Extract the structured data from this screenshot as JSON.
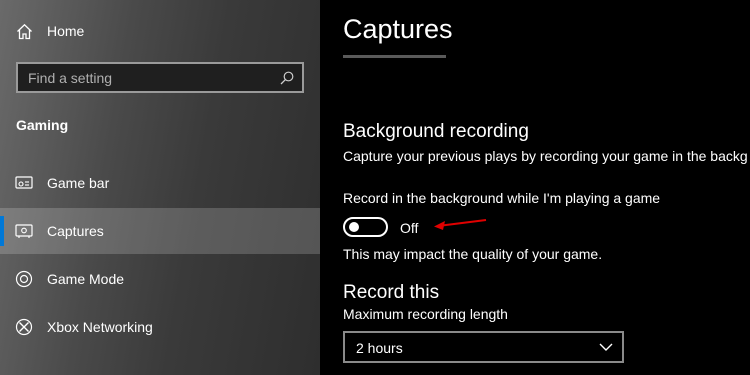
{
  "sidebar": {
    "home_label": "Home",
    "search_placeholder": "Find a setting",
    "section_title": "Gaming",
    "items": [
      {
        "label": "Game bar",
        "icon": "game-bar-icon"
      },
      {
        "label": "Captures",
        "icon": "captures-icon",
        "selected": true
      },
      {
        "label": "Game Mode",
        "icon": "game-mode-icon"
      },
      {
        "label": "Xbox Networking",
        "icon": "xbox-icon"
      }
    ]
  },
  "main": {
    "title": "Captures",
    "background_recording": {
      "heading": "Background recording",
      "description": "Capture your previous plays by recording your game in the backg",
      "toggle_label": "Record in the background while I'm playing a game",
      "toggle_state": "Off",
      "note": "This may impact the quality of your game."
    },
    "record_this": {
      "heading": "Record this",
      "max_length_label": "Maximum recording length",
      "max_length_value": "2 hours"
    }
  },
  "colors": {
    "accent": "#0078d7",
    "annotation_arrow": "#e00000"
  }
}
